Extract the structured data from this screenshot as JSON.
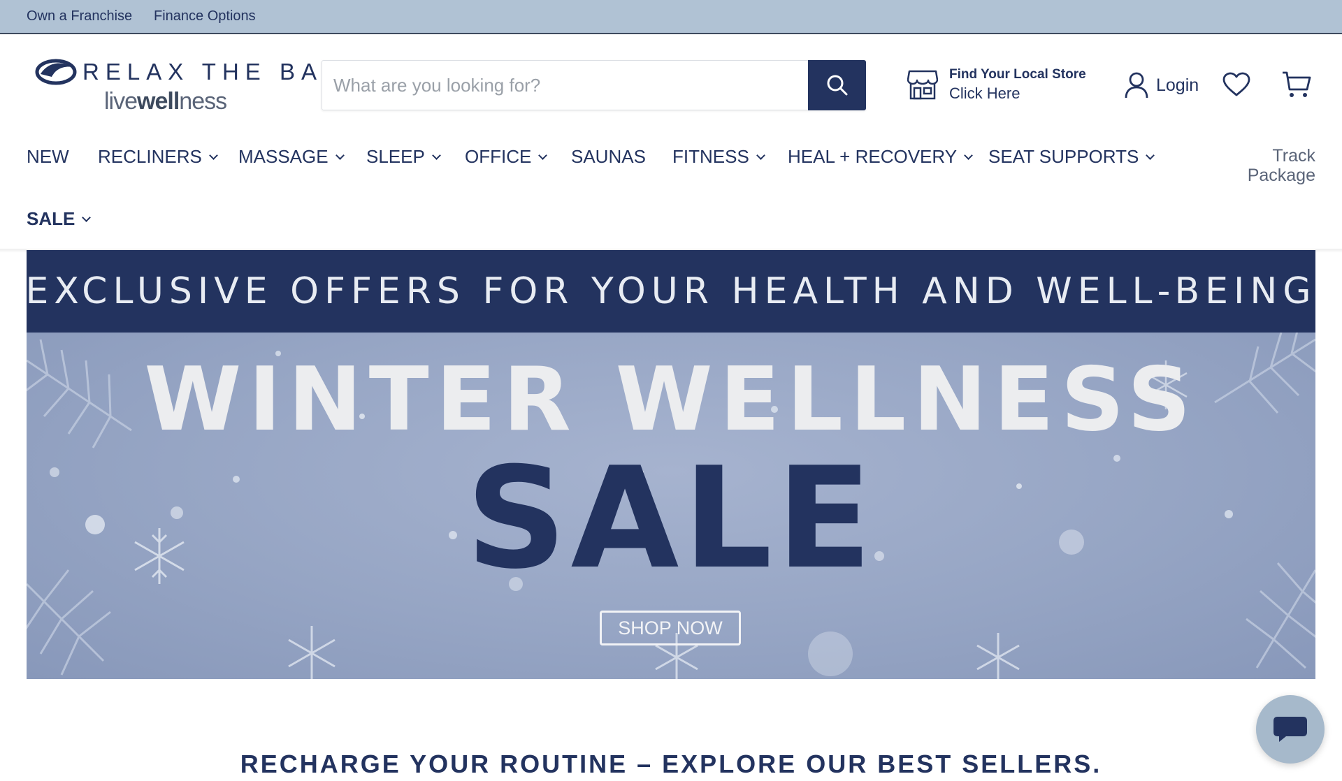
{
  "utility": {
    "franchise_label": "Own a Franchise",
    "finance_label": "Finance Options"
  },
  "brand": {
    "name": "RELAX THE BACK",
    "tagline_thin": "live",
    "tagline_bold": "well",
    "tagline_end": "ness",
    "primary_color": "#23335f",
    "utility_bar_color": "#b0c2d4"
  },
  "search": {
    "placeholder": "What are you looking for?",
    "value": "",
    "icon": "search-icon"
  },
  "store_locator": {
    "title": "Find Your Local Store",
    "link_label": "Click Here",
    "icon": "storefront-icon"
  },
  "account": {
    "login_label": "Login",
    "login_icon": "user-icon",
    "wishlist_icon": "heart-icon",
    "cart_icon": "cart-icon"
  },
  "nav": {
    "new": "NEW",
    "recliners": "RECLINERS",
    "massage": "MASSAGE",
    "sleep": "SLEEP",
    "office": "OFFICE",
    "saunas": "SAUNAS",
    "fitness": "FITNESS",
    "heal_recovery": "HEAL + RECOVERY",
    "seat_supports": "SEAT SUPPORTS",
    "sale": "SALE",
    "track_line1": "Track",
    "track_line2": "Package"
  },
  "hero": {
    "band_text": "EXCLUSIVE OFFERS FOR YOUR HEALTH AND WELL-BEING",
    "title_line1": "WINTER WELLNESS",
    "title_line2": "SALE",
    "cta_label": "SHOP NOW",
    "band_color": "#23335f",
    "bg_color": "#96a5c4"
  },
  "section": {
    "title": "RECHARGE YOUR ROUTINE – EXPLORE OUR BEST SELLERS."
  },
  "chat": {
    "icon": "chat-bubble-icon"
  }
}
